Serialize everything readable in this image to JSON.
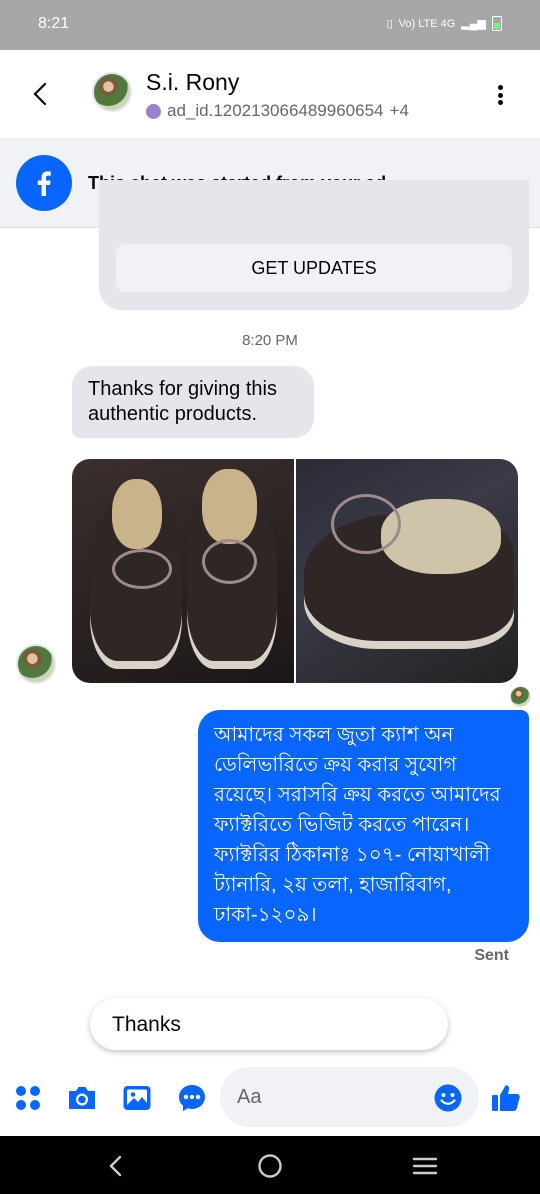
{
  "status_bar": {
    "time": "8:21",
    "network": "Vo) LTE 4G"
  },
  "header": {
    "contact_name": "S.i. Rony",
    "ad_id": "ad_id.120213066489960654",
    "extra_count": "+4"
  },
  "ad_banner": {
    "text": "This chat was started from your ad."
  },
  "updates_card": {
    "button_label": "GET UPDATES"
  },
  "conversation": {
    "timestamp": "8:20 PM",
    "incoming_message": "Thanks for giving this authentic products.",
    "outgoing_message": "আমাদের সকল জুতা ক্যাশ অন ডেলিভারিতে ক্রয় করার সুযোগ রয়েছে। সরাসরি ক্রয় করতে আমাদের ফ্যাক্টরিতে ভিজিট করতে পারেন। ফ্যাক্টরির ঠিকানাঃ ১০৭- নোয়াখালী ট্যানারি, ২য় তলা, হাজারিবাগ, ঢাকা-১২০৯।",
    "sent_status": "Sent"
  },
  "quick_reply": {
    "label": "Thanks"
  },
  "composer": {
    "placeholder": "Aa"
  },
  "colors": {
    "messenger_blue": "#0866ff",
    "bubble_gray": "#e4e6eb",
    "status_bar": "#a7a7a7"
  },
  "icons": [
    "back-arrow",
    "more-vertical",
    "facebook-logo",
    "grid-menu",
    "camera",
    "gallery",
    "chat-bubble",
    "emoji",
    "thumbs-up",
    "nav-back",
    "nav-home",
    "nav-recents"
  ]
}
